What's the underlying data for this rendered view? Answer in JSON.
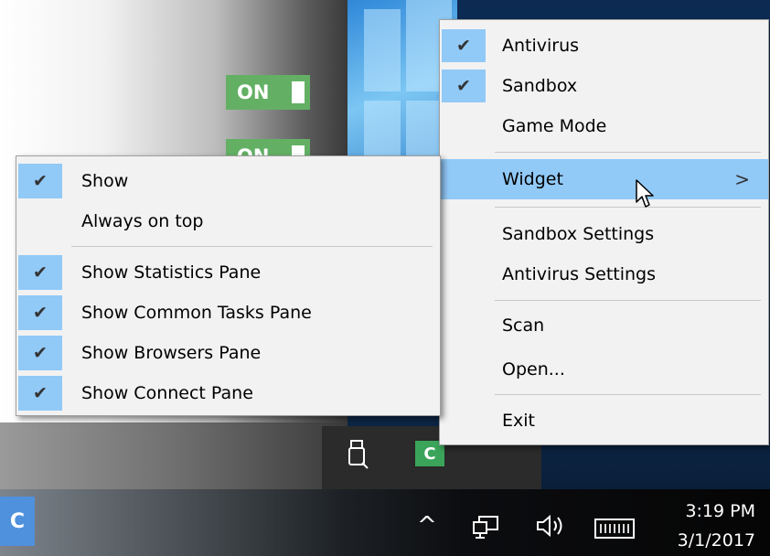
{
  "widget_background": {
    "toggle_antivirus": "ON",
    "toggle_sandbox": "ON"
  },
  "tray_menu": {
    "items": [
      {
        "label": "Antivirus",
        "checked": true
      },
      {
        "label": "Sandbox",
        "checked": true
      },
      {
        "label": "Game Mode",
        "checked": false
      },
      {
        "label": "Widget",
        "has_submenu": true,
        "highlighted": true,
        "arrow": ">"
      },
      {
        "label": "Sandbox Settings"
      },
      {
        "label": "Antivirus Settings"
      },
      {
        "label": "Scan"
      },
      {
        "label": "Open..."
      },
      {
        "label": "Exit"
      }
    ]
  },
  "widget_menu": {
    "items": [
      {
        "label": "Show",
        "checked": true
      },
      {
        "label": "Always on top",
        "checked": false
      },
      {
        "label": "Show Statistics Pane",
        "checked": true
      },
      {
        "label": "Show Common Tasks Pane",
        "checked": true
      },
      {
        "label": "Show Browsers Pane",
        "checked": true
      },
      {
        "label": "Show Connect Pane",
        "checked": true
      }
    ]
  },
  "icons": {
    "check": "✔",
    "chevron_up": "^",
    "comodo_tray": "C",
    "taskbar_app": "C"
  },
  "taskbar": {
    "time": "3:19 PM",
    "date": "3/1/2017"
  },
  "colors": {
    "menu_bg": "#f2f2f2",
    "highlight": "#91c9f7",
    "toggle_on": "#63b065"
  }
}
